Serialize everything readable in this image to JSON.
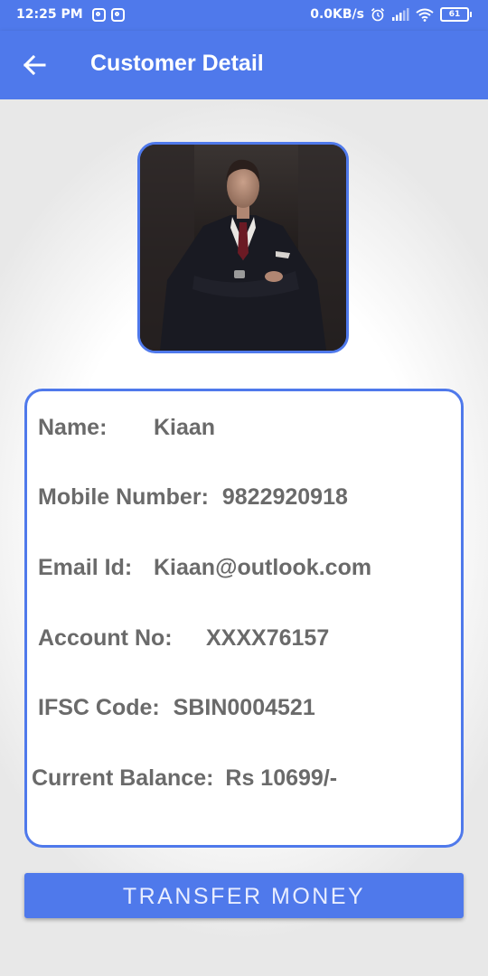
{
  "status_bar": {
    "time": "12:25 PM",
    "net_speed": "0.0KB/s",
    "battery": "61"
  },
  "header": {
    "title": "Customer Detail"
  },
  "customer": {
    "name_label": "Name:",
    "name": "Kiaan",
    "mobile_label": "Mobile Number:",
    "mobile": "9822920918",
    "email_label": "Email Id:",
    "email": "Kiaan@outlook.com",
    "account_label": "Account No:",
    "account": "XXXX76157",
    "ifsc_label": "IFSC Code:",
    "ifsc": "SBIN0004521",
    "balance_label": "Current Balance:",
    "balance": "Rs 10699/-"
  },
  "actions": {
    "transfer_label": "TRANSFER MONEY"
  },
  "colors": {
    "primary": "#4f79eb",
    "text_gray": "#6a6a6a"
  },
  "icons": {
    "back": "arrow-left-icon",
    "notifications": "instagram-icon",
    "alarm": "alarm-icon",
    "signal": "signal-icon",
    "wifi": "wifi-icon",
    "battery": "battery-icon"
  }
}
